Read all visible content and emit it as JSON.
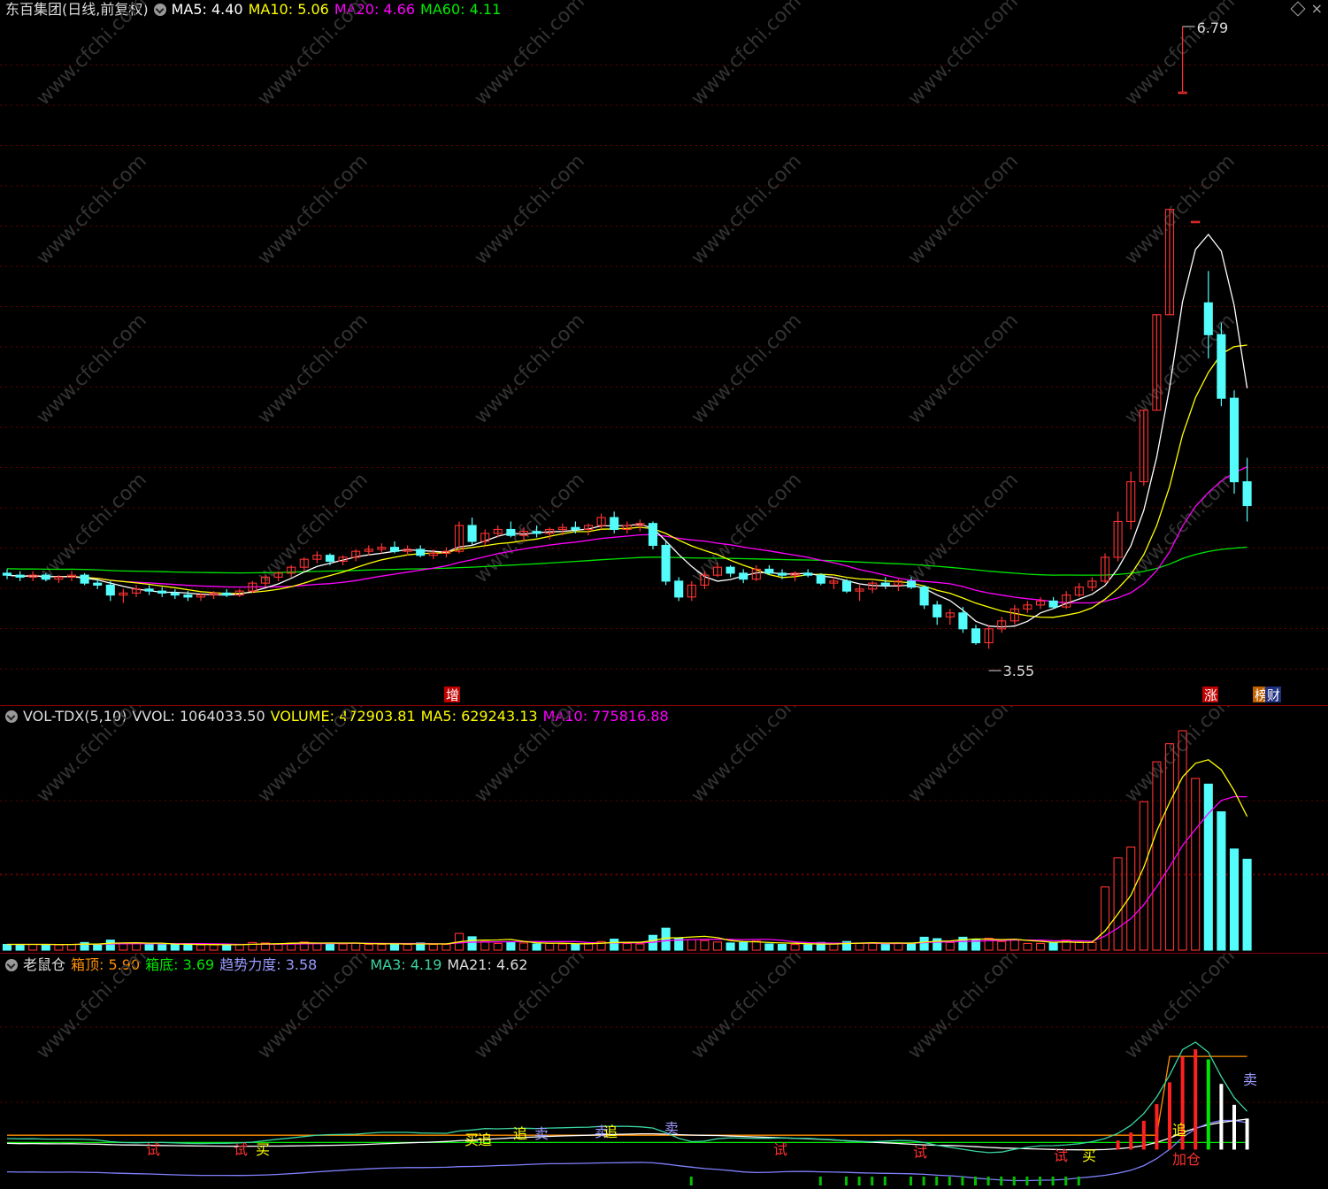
{
  "main": {
    "title": "东百集团(日线,前复权)",
    "ma5": "MA5: 4.40",
    "ma10": "MA10: 5.06",
    "ma20": "MA20: 4.66",
    "ma60": "MA60: 4.11",
    "colors": {
      "up": "#ff3232",
      "down": "#54fcfc",
      "ma5": "#ffffff",
      "ma10": "#ffff00",
      "ma20": "#ff00ff",
      "ma60": "#00e600"
    },
    "high_label": "6.79",
    "low_label": "3.55",
    "markers": [
      "增",
      "涨",
      "榜",
      "财"
    ],
    "close_button": "×"
  },
  "volume": {
    "name": "VOL-TDX(5,10)",
    "vvol": "VVOL: 1064033.50",
    "volume": "VOLUME: 472903.81",
    "ma5": "MA5: 629243.13",
    "ma10": "MA10: 775816.88"
  },
  "indicator": {
    "name": "老鼠仓",
    "top_label": "箱顶: ",
    "top_value": "5.90",
    "bottom_label": "箱底: ",
    "bottom_value": "3.69",
    "trend_label": "趋势力度: ",
    "trend_value": "3.58",
    "ma3": "MA3: 4.19",
    "ma21": "MA21: 4.62",
    "signals": [
      "试",
      "试",
      "买",
      "买",
      "追",
      "追",
      "卖",
      "卖",
      "追",
      "卖",
      "试",
      "试",
      "试",
      "买",
      "追",
      "卖",
      "加仓"
    ]
  },
  "watermark": "www.cfchi.com",
  "chart_data": {
    "type": "candlestick",
    "title": "东百集团(日线,前复权)",
    "price_min": 3.55,
    "price_max": 6.79,
    "candles_ohlc": [
      [
        4.04,
        4.06,
        4.01,
        4.03
      ],
      [
        4.03,
        4.05,
        4.0,
        4.02
      ],
      [
        4.02,
        4.05,
        4.0,
        4.03
      ],
      [
        4.03,
        4.04,
        4.0,
        4.01
      ],
      [
        4.01,
        4.03,
        3.99,
        4.02
      ],
      [
        4.02,
        4.05,
        4.0,
        4.03
      ],
      [
        4.03,
        4.04,
        3.98,
        3.99
      ],
      [
        3.99,
        4.01,
        3.96,
        3.98
      ],
      [
        3.98,
        4.0,
        3.9,
        3.93
      ],
      [
        3.93,
        3.96,
        3.89,
        3.94
      ],
      [
        3.94,
        3.98,
        3.92,
        3.96
      ],
      [
        3.96,
        3.98,
        3.93,
        3.95
      ],
      [
        3.95,
        3.97,
        3.92,
        3.94
      ],
      [
        3.94,
        3.96,
        3.91,
        3.93
      ],
      [
        3.93,
        3.95,
        3.9,
        3.92
      ],
      [
        3.92,
        3.94,
        3.9,
        3.93
      ],
      [
        3.93,
        3.95,
        3.91,
        3.94
      ],
      [
        3.94,
        3.96,
        3.92,
        3.93
      ],
      [
        3.93,
        3.96,
        3.92,
        3.95
      ],
      [
        3.95,
        4.0,
        3.94,
        3.99
      ],
      [
        3.99,
        4.03,
        3.97,
        4.02
      ],
      [
        4.02,
        4.05,
        4.0,
        4.04
      ],
      [
        4.04,
        4.08,
        4.02,
        4.07
      ],
      [
        4.07,
        4.12,
        4.05,
        4.11
      ],
      [
        4.11,
        4.15,
        4.09,
        4.13
      ],
      [
        4.13,
        4.14,
        4.08,
        4.1
      ],
      [
        4.1,
        4.13,
        4.08,
        4.12
      ],
      [
        4.12,
        4.16,
        4.1,
        4.15
      ],
      [
        4.15,
        4.18,
        4.13,
        4.16
      ],
      [
        4.16,
        4.19,
        4.14,
        4.17
      ],
      [
        4.17,
        4.2,
        4.14,
        4.15
      ],
      [
        4.15,
        4.18,
        4.13,
        4.16
      ],
      [
        4.16,
        4.18,
        4.12,
        4.13
      ],
      [
        4.13,
        4.16,
        4.11,
        4.14
      ],
      [
        4.14,
        4.17,
        4.12,
        4.15
      ],
      [
        4.15,
        4.3,
        4.14,
        4.28
      ],
      [
        4.28,
        4.32,
        4.18,
        4.2
      ],
      [
        4.2,
        4.26,
        4.18,
        4.24
      ],
      [
        4.24,
        4.28,
        4.22,
        4.26
      ],
      [
        4.26,
        4.3,
        4.22,
        4.23
      ],
      [
        4.23,
        4.27,
        4.2,
        4.25
      ],
      [
        4.25,
        4.28,
        4.22,
        4.24
      ],
      [
        4.24,
        4.27,
        4.21,
        4.26
      ],
      [
        4.26,
        4.29,
        4.23,
        4.27
      ],
      [
        4.27,
        4.3,
        4.24,
        4.26
      ],
      [
        4.26,
        4.29,
        4.23,
        4.28
      ],
      [
        4.28,
        4.34,
        4.26,
        4.32
      ],
      [
        4.32,
        4.35,
        4.24,
        4.26
      ],
      [
        4.26,
        4.3,
        4.24,
        4.28
      ],
      [
        4.28,
        4.31,
        4.25,
        4.29
      ],
      [
        4.29,
        4.3,
        4.16,
        4.18
      ],
      [
        4.18,
        4.2,
        3.98,
        4.0
      ],
      [
        4.0,
        4.02,
        3.9,
        3.92
      ],
      [
        3.92,
        4.0,
        3.9,
        3.98
      ],
      [
        3.98,
        4.05,
        3.96,
        4.03
      ],
      [
        4.03,
        4.09,
        4.02,
        4.07
      ],
      [
        4.07,
        4.08,
        4.02,
        4.04
      ],
      [
        4.04,
        4.06,
        3.99,
        4.01
      ],
      [
        4.01,
        4.08,
        4.0,
        4.06
      ],
      [
        4.06,
        4.08,
        4.03,
        4.04
      ],
      [
        4.04,
        4.06,
        4.01,
        4.03
      ],
      [
        4.03,
        4.05,
        4.0,
        4.04
      ],
      [
        4.04,
        4.06,
        4.02,
        4.03
      ],
      [
        4.03,
        4.04,
        3.98,
        3.99
      ],
      [
        3.99,
        4.02,
        3.96,
        4.0
      ],
      [
        4.0,
        4.01,
        3.94,
        3.95
      ],
      [
        3.95,
        3.98,
        3.9,
        3.96
      ],
      [
        3.96,
        4.0,
        3.94,
        3.99
      ],
      [
        3.99,
        4.02,
        3.96,
        3.98
      ],
      [
        3.98,
        4.01,
        3.95,
        4.0
      ],
      [
        4.0,
        4.02,
        3.96,
        3.97
      ],
      [
        3.97,
        3.98,
        3.86,
        3.88
      ],
      [
        3.88,
        3.9,
        3.78,
        3.82
      ],
      [
        3.82,
        3.86,
        3.78,
        3.84
      ],
      [
        3.84,
        3.87,
        3.74,
        3.76
      ],
      [
        3.76,
        3.78,
        3.68,
        3.69
      ],
      [
        3.69,
        3.78,
        3.66,
        3.76
      ],
      [
        3.76,
        3.82,
        3.74,
        3.8
      ],
      [
        3.8,
        3.88,
        3.78,
        3.86
      ],
      [
        3.86,
        3.9,
        3.84,
        3.88
      ],
      [
        3.88,
        3.92,
        3.86,
        3.9
      ],
      [
        3.9,
        3.92,
        3.86,
        3.87
      ],
      [
        3.87,
        3.95,
        3.86,
        3.93
      ],
      [
        3.93,
        3.99,
        3.92,
        3.97
      ],
      [
        3.97,
        4.02,
        3.95,
        4.0
      ],
      [
        4.0,
        4.14,
        3.99,
        4.12
      ],
      [
        4.12,
        4.35,
        4.1,
        4.3
      ],
      [
        4.3,
        4.55,
        4.26,
        4.5
      ],
      [
        4.5,
        4.86,
        4.48,
        4.86
      ],
      [
        4.86,
        5.34,
        4.86,
        5.34
      ],
      [
        5.34,
        5.87,
        5.34,
        5.87
      ],
      [
        6.46,
        6.79,
        6.46,
        6.46
      ],
      [
        5.81,
        5.81,
        5.81,
        5.81
      ],
      [
        5.4,
        5.56,
        5.12,
        5.24
      ],
      [
        5.24,
        5.3,
        4.88,
        4.92
      ],
      [
        4.92,
        4.96,
        4.44,
        4.5
      ],
      [
        4.5,
        4.62,
        4.3,
        4.38
      ]
    ],
    "ma": {
      "MA5": 4.4,
      "MA10": 5.06,
      "MA20": 4.66,
      "MA60": 4.11
    },
    "volume": {
      "VVOL": 1064033.5,
      "VOLUME": 472903.81,
      "MA5": 629243.13,
      "MA10": 775816.88
    },
    "indicator": {
      "箱顶": 5.9,
      "箱底": 3.69,
      "趋势力度": 3.58,
      "MA3": 4.19,
      "MA21": 4.62
    }
  }
}
